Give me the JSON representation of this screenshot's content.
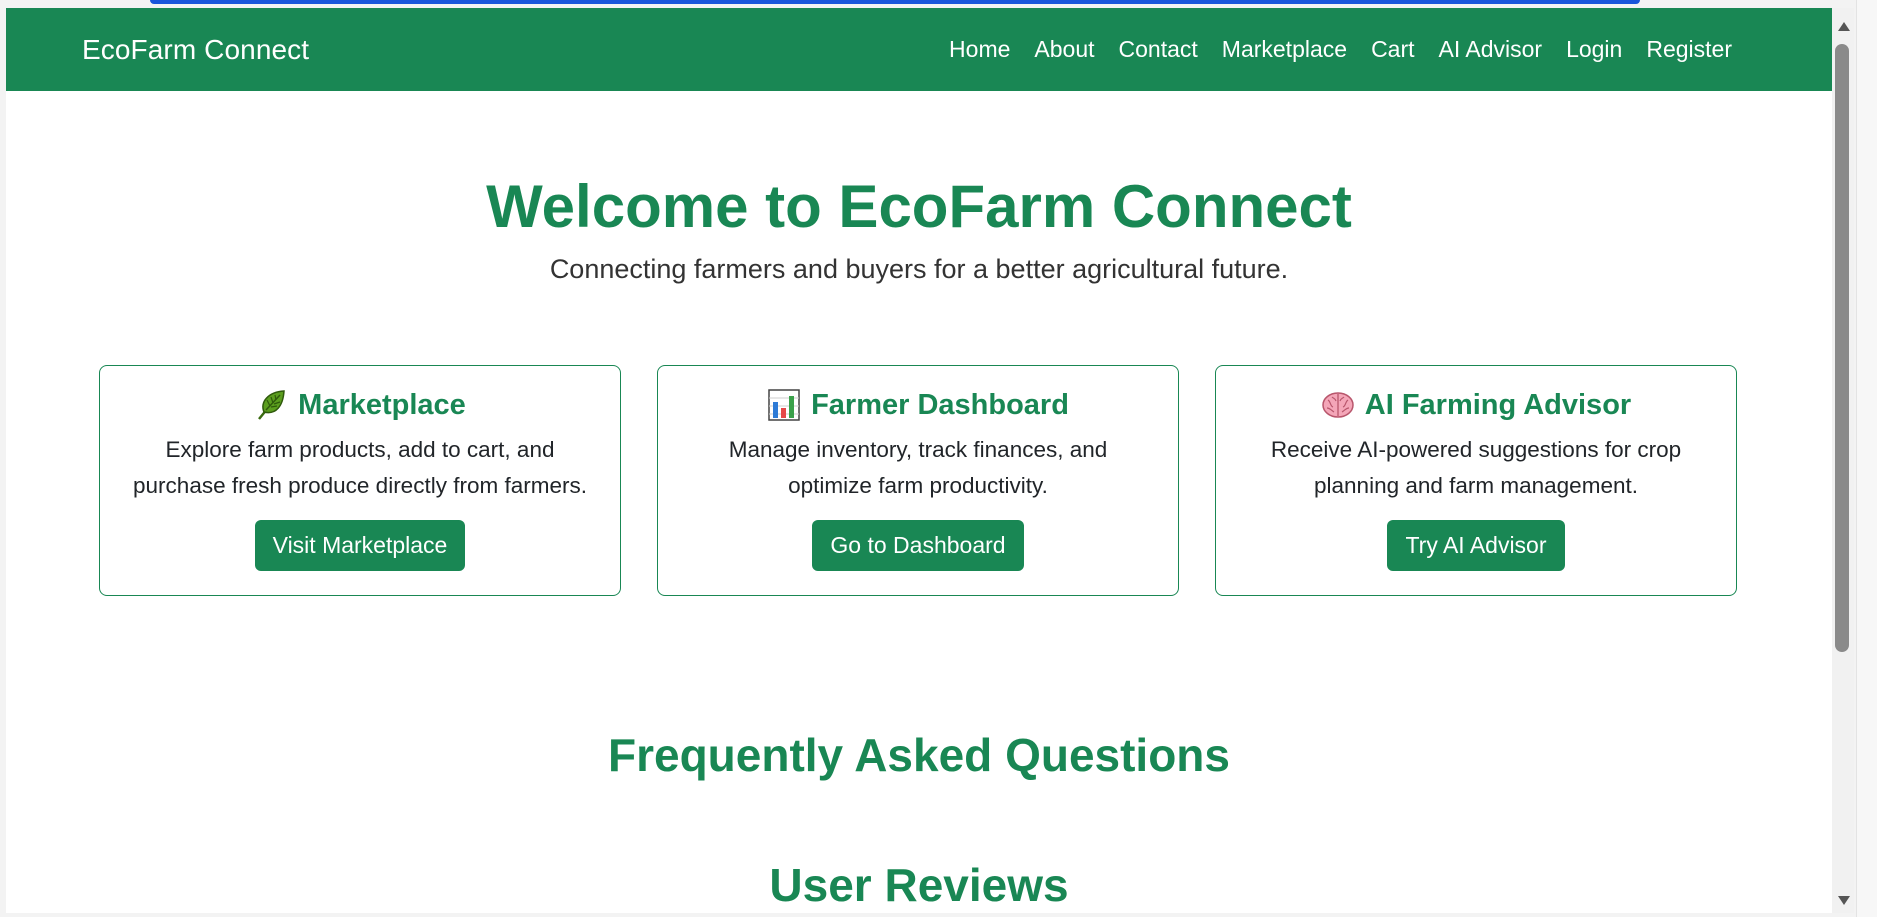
{
  "navbar": {
    "brand": "EcoFarm Connect",
    "links": [
      "Home",
      "About",
      "Contact",
      "Marketplace",
      "Cart",
      "AI Advisor",
      "Login",
      "Register"
    ]
  },
  "hero": {
    "title": "Welcome to EcoFarm Connect",
    "subtitle": "Connecting farmers and buyers for a better agricultural future."
  },
  "cards": [
    {
      "icon": "leaf-icon",
      "title": "Marketplace",
      "text": "Explore farm products, add to cart, and purchase fresh produce directly from farmers.",
      "button": "Visit Marketplace"
    },
    {
      "icon": "bar-chart-icon",
      "title": "Farmer Dashboard",
      "text": "Manage inventory, track finances, and optimize farm productivity.",
      "button": "Go to Dashboard"
    },
    {
      "icon": "brain-icon",
      "title": "AI Farming Advisor",
      "text": "Receive AI-powered suggestions for crop planning and farm management.",
      "button": "Try AI Advisor"
    }
  ],
  "sections": {
    "faq_title": "Frequently Asked Questions",
    "reviews_title": "User Reviews"
  },
  "colors": {
    "primary": "#198754",
    "accent": "#1a56db"
  }
}
